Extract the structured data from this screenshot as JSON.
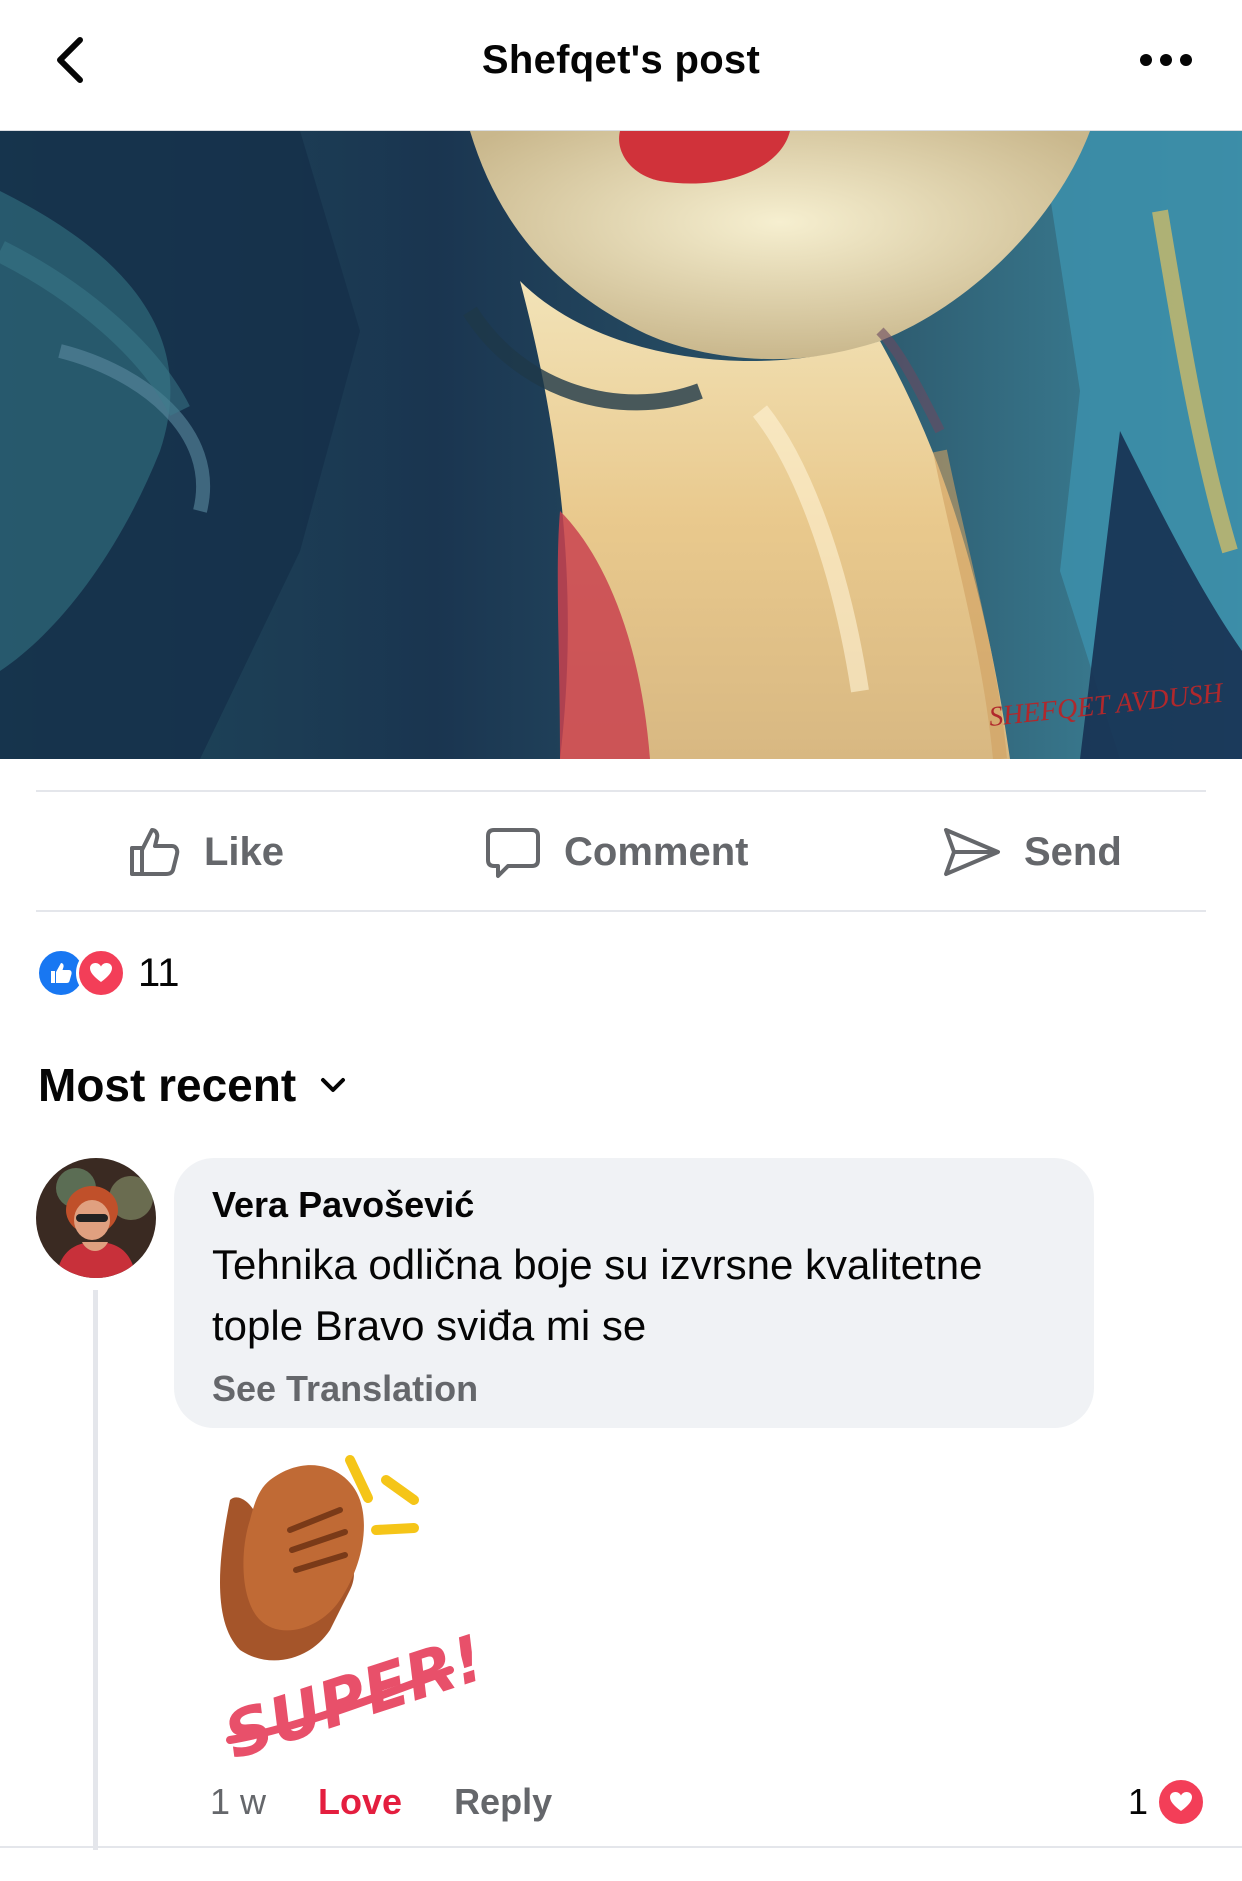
{
  "header": {
    "title": "Shefqet's post",
    "back_icon": "chevron-left-icon",
    "more_icon": "ellipsis-icon"
  },
  "post": {
    "image_description": "painting",
    "signature": "SHEFQET AVDUSH"
  },
  "actions": {
    "like": "Like",
    "comment": "Comment",
    "send": "Send"
  },
  "reactions": {
    "count": "11",
    "types": [
      "like",
      "love"
    ]
  },
  "sort": {
    "label": "Most recent"
  },
  "comment": {
    "author": "Vera Pavošević",
    "text": "Tehnika odlična boje su izvrsne kvalitetne tople Bravo sviđa mi se",
    "see_translation": "See Translation",
    "sticker_text": "SUPER!",
    "time": "1 w",
    "love_label": "Love",
    "reply_label": "Reply",
    "reaction_count": "1"
  },
  "colors": {
    "like_blue": "#1877f2",
    "love_red": "#f33e58",
    "text_secondary": "#65676b",
    "bubble_bg": "#f0f2f5"
  }
}
